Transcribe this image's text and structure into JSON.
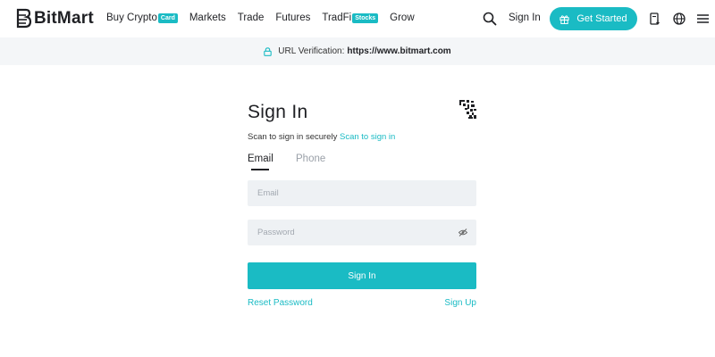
{
  "brand": {
    "name": "BitMart",
    "accent": "#1abbc4"
  },
  "nav": [
    {
      "label": "Buy Crypto",
      "tag": "Card"
    },
    {
      "label": "Markets"
    },
    {
      "label": "Trade"
    },
    {
      "label": "Futures"
    },
    {
      "label": "TradFi",
      "tag": "Stocks"
    },
    {
      "label": "Grow"
    }
  ],
  "header": {
    "sign_in": "Sign In",
    "get_started": "Get Started",
    "icons": [
      "search-icon",
      "gift-icon",
      "download-icon",
      "globe-icon",
      "menu-icon"
    ]
  },
  "verify": {
    "label": "URL Verification:",
    "url": "https://www.bitmart.com"
  },
  "form": {
    "title": "Sign In",
    "scan_text": "Scan to sign in securely",
    "scan_link": "Scan to sign in",
    "tabs": [
      {
        "label": "Email",
        "active": true
      },
      {
        "label": "Phone",
        "active": false
      }
    ],
    "email_placeholder": "Email",
    "password_placeholder": "Password",
    "submit": "Sign In",
    "reset": "Reset Password",
    "signup": "Sign Up"
  }
}
